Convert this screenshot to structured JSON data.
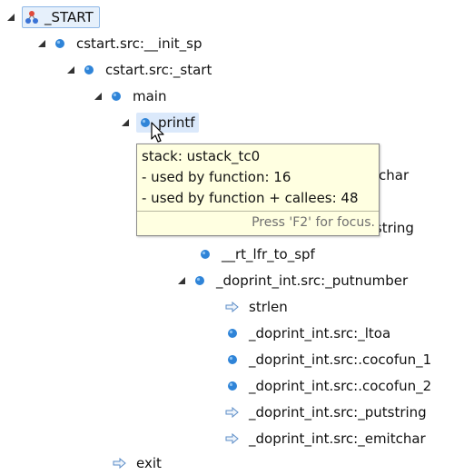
{
  "tree": {
    "start": "_START",
    "init_sp": "cstart.src:__init_sp",
    "cstart_start": "cstart.src:_start",
    "main": "main",
    "printf": "printf",
    "obscured_1": "itchar",
    "obscured_2": "tstring",
    "rt_lfr_to_spf": "__rt_lfr_to_spf",
    "putnumber": "_doprint_int.src:_putnumber",
    "strlen": "strlen",
    "ltoa": "_doprint_int.src:_ltoa",
    "cocofun_1": "_doprint_int.src:.cocofun_1",
    "cocofun_2": "_doprint_int.src:.cocofun_2",
    "putstring": "_doprint_int.src:_putstring",
    "emitchar": "_doprint_int.src:_emitchar",
    "exit": "exit"
  },
  "tooltip": {
    "line1": "stack: ustack_tc0",
    "line2": "- used by function: 16",
    "line3": "- used by function + callees: 48",
    "focus_hint": "Press 'F2' for focus."
  },
  "colors": {
    "selection_bg": "#e6f0fb",
    "selection_border": "#8fb8e6",
    "function_dot": "#2f84d8",
    "tooltip_bg": "#ffffe1"
  },
  "icons": {
    "expanded_twistie": "triangle-down-right",
    "function": "blue-dot",
    "call_arrow": "hollow-right-arrow",
    "root": "call-graph-root"
  }
}
